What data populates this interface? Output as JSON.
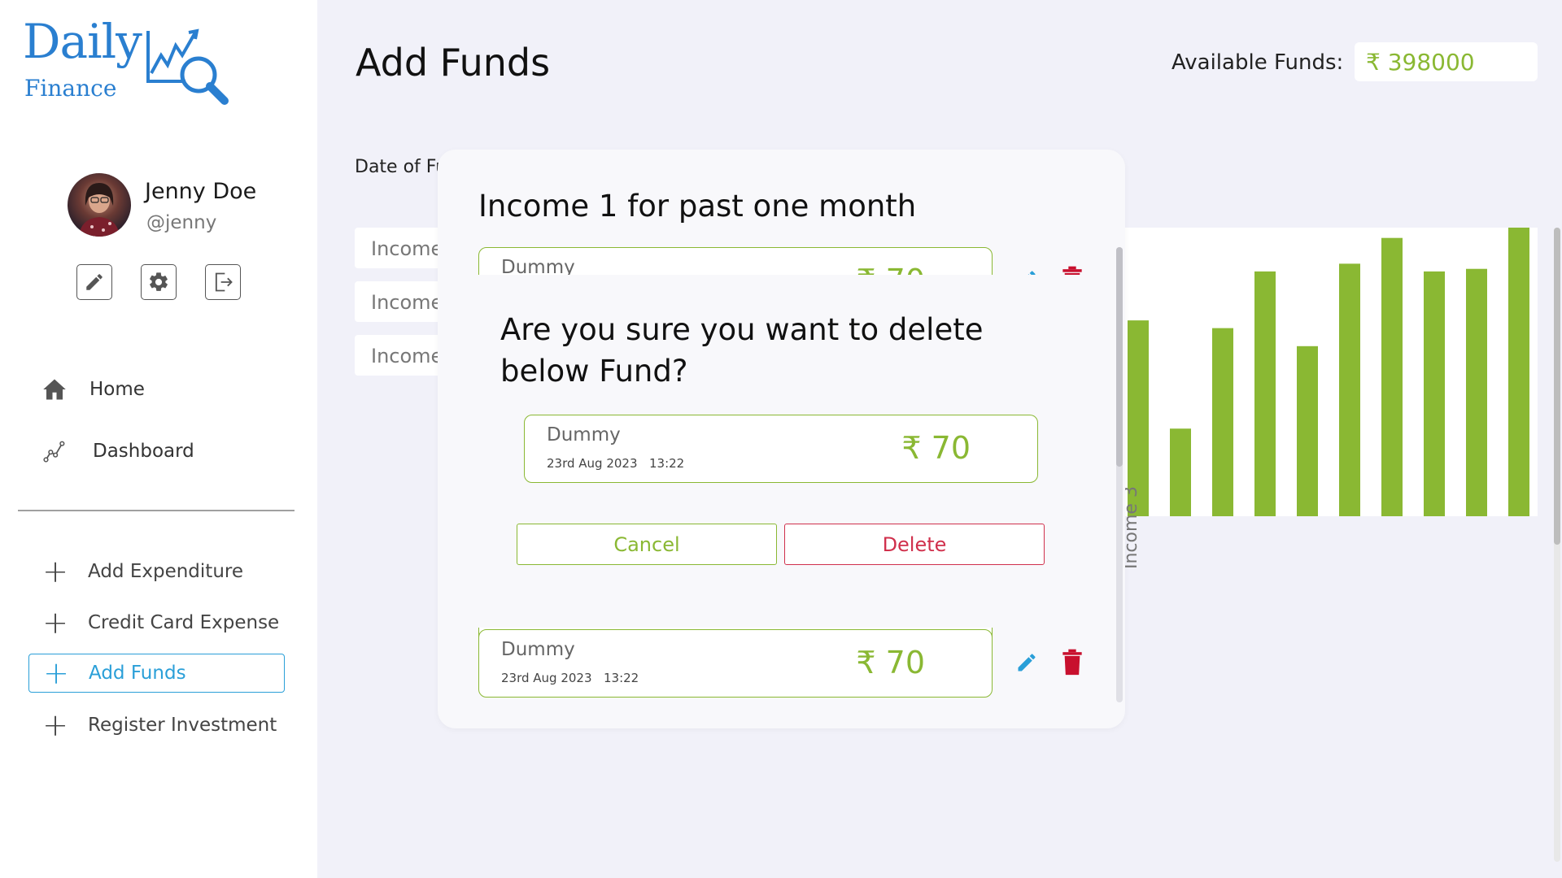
{
  "logo": {
    "daily": "Daily",
    "finance": "Finance"
  },
  "profile": {
    "name": "Jenny Doe",
    "handle": "@jenny"
  },
  "nav": {
    "home": "Home",
    "dashboard": "Dashboard"
  },
  "actions": [
    {
      "label": "Add Expenditure"
    },
    {
      "label": "Credit Card Expense"
    },
    {
      "label": "Add Funds"
    },
    {
      "label": "Register Investment"
    }
  ],
  "page": {
    "title": "Add Funds",
    "available_label": "Available Funds:",
    "available_value": "₹ 398000",
    "date_label": "Date of Fu",
    "income_tabs": [
      "Income",
      "Income",
      "Income"
    ]
  },
  "chart_data": {
    "type": "bar",
    "values": [
      76,
      34,
      73,
      95,
      66,
      98,
      108,
      95,
      96,
      112
    ],
    "ylim": [
      0,
      112
    ],
    "xlabel": "Income 3",
    "color": "#8ab833"
  },
  "modal": {
    "title": "Income 1 for past one month",
    "funds": [
      {
        "name": "Dummy",
        "amount": "₹ 70"
      },
      {
        "name": "Dummy",
        "date": "23rd Aug 2023",
        "time": "13:22",
        "amount": "₹ 70"
      }
    ]
  },
  "confirm": {
    "title": "Are you sure you want to delete below Fund?",
    "fund": {
      "name": "Dummy",
      "date": "23rd Aug 2023",
      "time": "13:22",
      "amount": "₹ 70"
    },
    "cancel_label": "Cancel",
    "delete_label": "Delete"
  },
  "colors": {
    "accent": "#2a9fd8",
    "positive": "#8ab833",
    "danger": "#d0304c"
  }
}
